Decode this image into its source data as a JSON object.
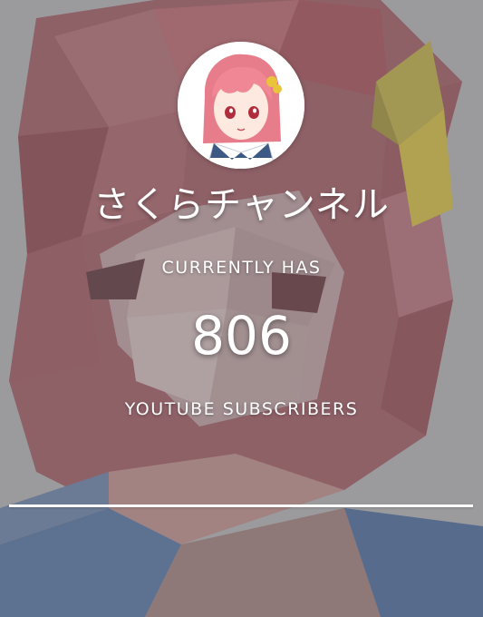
{
  "channel": {
    "name": "さくらチャンネル",
    "avatar_alt": "avatar"
  },
  "stats": {
    "prefix_label": "CURRENTLY HAS",
    "subscriber_count": "806",
    "suffix_label": "YOUTUBE SUBSCRIBERS"
  },
  "colors": {
    "background": "#9a9a9c",
    "text": "#ffffff",
    "hair": "#e8808d",
    "accent_yellow": "#b9a534"
  }
}
